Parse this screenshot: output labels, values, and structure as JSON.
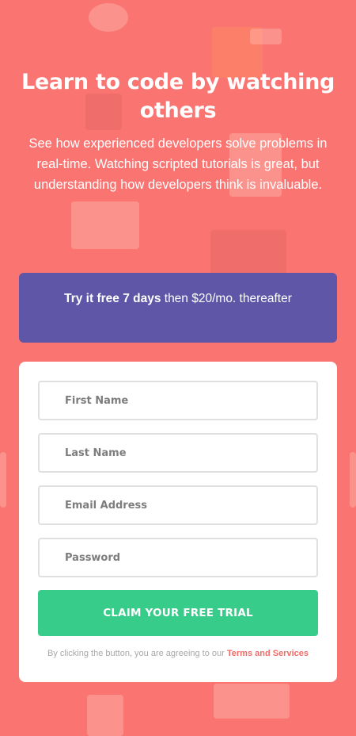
{
  "hero": {
    "title": "Learn to code by watching others",
    "subtitle": "See how experienced developers solve problems in real-time. Watching scripted tutorials is great, but understanding how developers think is invaluable."
  },
  "offer": {
    "bold": "Try it free 7 days",
    "rest": " then $20/mo. thereafter"
  },
  "form": {
    "first_name_placeholder": "First Name",
    "last_name_placeholder": "Last Name",
    "email_placeholder": "Email Address",
    "password_placeholder": "Password",
    "submit_label": "CLAIM YOUR FREE TRIAL",
    "terms_prefix": "By clicking the button, you are agreeing to our ",
    "terms_link": "Terms and Services"
  },
  "colors": {
    "background": "#fa7572",
    "offer_bg": "#5f56a8",
    "cta_bg": "#37cc8a",
    "terms_link": "#f06d68"
  }
}
